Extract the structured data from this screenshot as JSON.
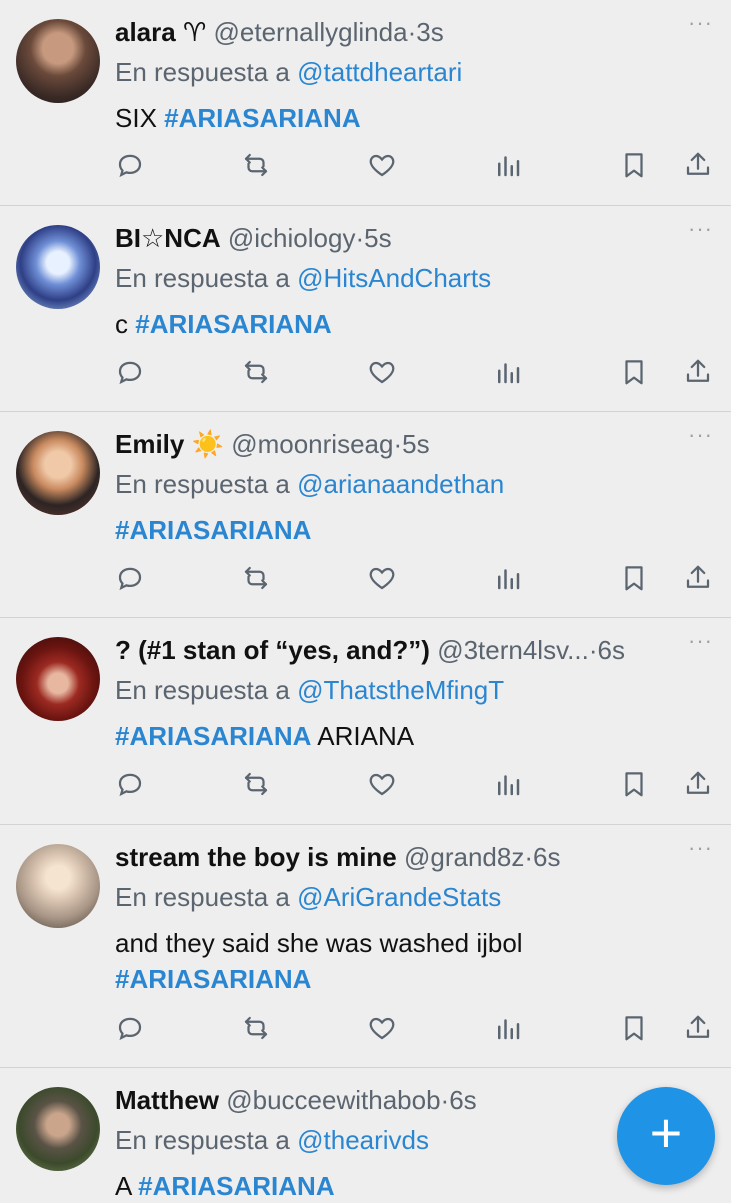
{
  "tweets": [
    {
      "name": "alara ♈︎",
      "handle": "@eternallyglinda",
      "time": "3s",
      "reply_prefix": "En respuesta a",
      "reply_to": "@tattdheartari",
      "text_plain": "SIX ",
      "text_tag": "#ARIASARIANA"
    },
    {
      "name": "BI☆NCA",
      "handle": "@ichiology",
      "time": "5s",
      "reply_prefix": "En respuesta a",
      "reply_to": "@HitsAndCharts",
      "text_plain": "c ",
      "text_tag": "#ARIASARIANA"
    },
    {
      "name": "Emily ☀️",
      "handle": "@moonriseag",
      "time": "5s",
      "reply_prefix": "En respuesta a",
      "reply_to": "@arianaandethan",
      "text_tag": "#ARIASARIANA"
    },
    {
      "name": "? (#1 stan of “yes, and?”)",
      "handle": "@3tern4lsv...",
      "time": "6s",
      "reply_prefix": "En respuesta a",
      "reply_to": "@ThatstheMfingT",
      "text_tag": "#ARIASARIANA",
      "text_after": " ARIANA"
    },
    {
      "name": "stream the boy is mine",
      "handle": "@grand8z",
      "time": "6s",
      "reply_prefix": "En respuesta a",
      "reply_to": "@AriGrandeStats",
      "text_plain": "and they said she was washed ijbol",
      "text_tag": "#ARIASARIANA"
    },
    {
      "name": "Matthew",
      "handle": "@bucceewithabob",
      "time": "6s",
      "reply_prefix": "En respuesta a",
      "reply_to": "@thearivds",
      "text_plain": "A ",
      "text_tag": "#ARIASARIANA"
    }
  ],
  "dot": "·",
  "more_label": "···",
  "fab_label": "+",
  "colors": {
    "accent": "#2a86d1",
    "fab": "#1f93e6",
    "background": "#efeeee"
  },
  "icons": [
    "reply-icon",
    "retweet-icon",
    "like-icon",
    "views-icon",
    "bookmark-icon",
    "share-icon"
  ]
}
